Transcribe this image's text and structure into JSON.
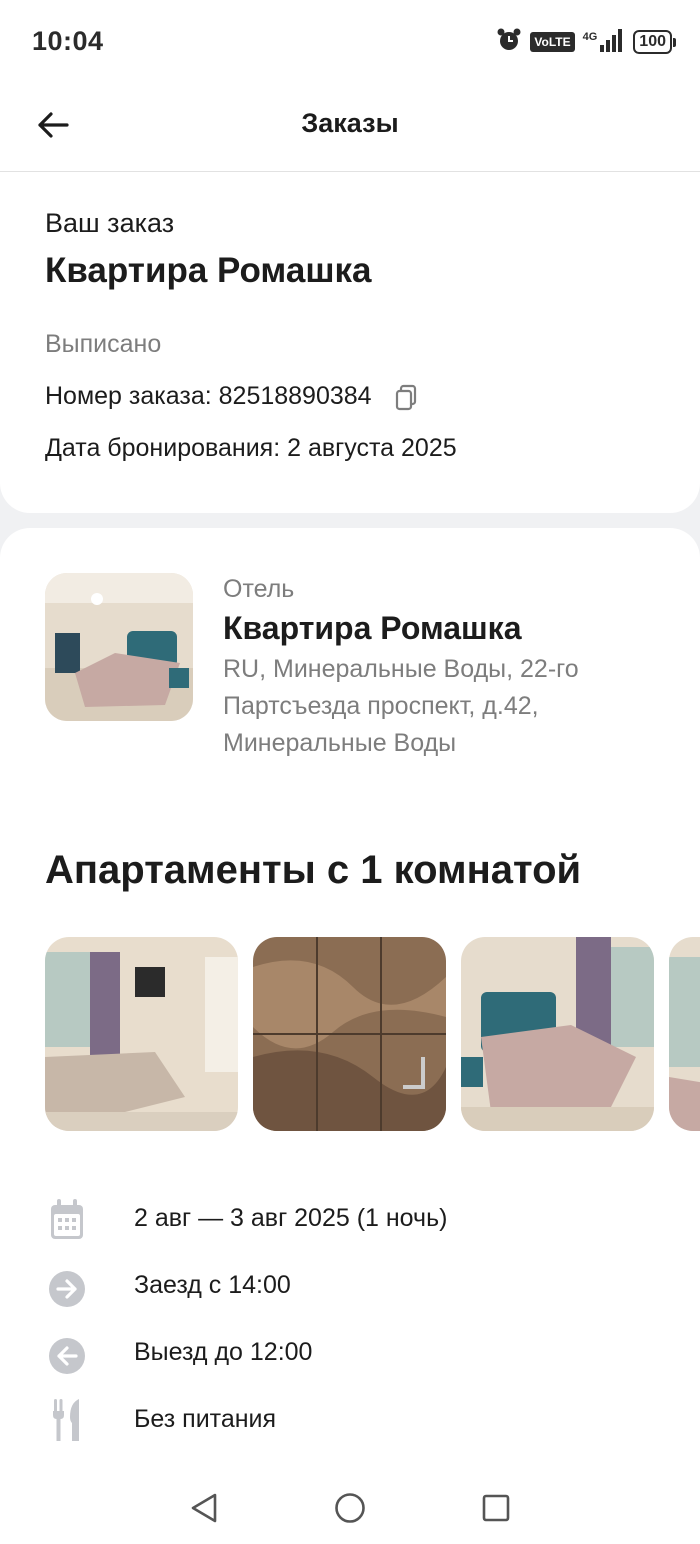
{
  "status_bar": {
    "time": "10:04",
    "volte": "VoLTE",
    "network": "4G",
    "battery": "100"
  },
  "app_bar": {
    "title": "Заказы"
  },
  "order_card": {
    "label": "Ваш заказ",
    "name": "Квартира Ромашка",
    "status": "Выписано",
    "number_label": "Номер заказа: 82518890384",
    "booking_date": "Дата бронирования: 2 августа 2025"
  },
  "hotel": {
    "type": "Отель",
    "name": "Квартира Ромашка",
    "address": "RU, Минеральные Воды, 22-го Партсъезда проспект, д.42, Минеральные Воды"
  },
  "room": {
    "title": "Апартаменты с 1 комнатой"
  },
  "details": [
    {
      "icon": "calendar-icon",
      "text": "2 авг — 3 авг 2025 (1 ночь)"
    },
    {
      "icon": "arrow-right-circle-icon",
      "text": "Заезд с 14:00"
    },
    {
      "icon": "arrow-left-circle-icon",
      "text": "Выезд до 12:00"
    },
    {
      "icon": "fork-knife-icon",
      "text": "Без питания"
    }
  ],
  "colors": {
    "text_primary": "#1c1c1c",
    "text_secondary": "#7d7d7d",
    "icon_gray": "#c5c7cc",
    "background_gray": "#f0f1f3"
  }
}
